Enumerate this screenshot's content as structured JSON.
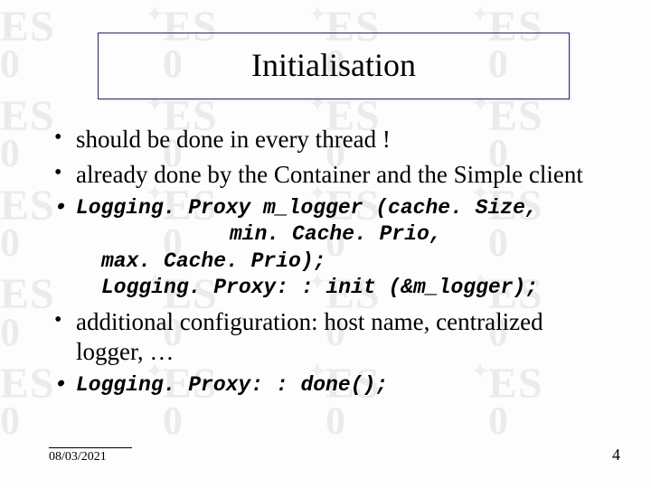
{
  "title": "Initialisation",
  "bullets": {
    "b1": "should be done in every thread !",
    "b2": "already done by the Container and the Simple client",
    "b3_l1": "Logging. Proxy m_logger (cache. Size,",
    "b3_l2": "min. Cache. Prio,",
    "b3_l3": "max. Cache. Prio);",
    "b3_l4": "Logging. Proxy: : init (&m_logger);",
    "b4": "additional configuration: host name, centralized logger, …",
    "b5": "Logging. Proxy: : done();"
  },
  "footer": {
    "date": "08/03/2021",
    "page": "4"
  },
  "watermark": {
    "text_top": "ES",
    "text_bottom": "0"
  }
}
